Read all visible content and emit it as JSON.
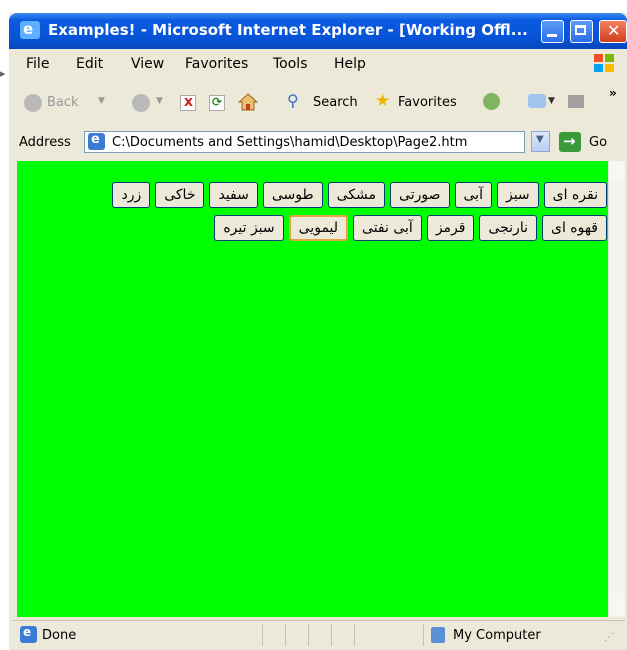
{
  "window": {
    "title": "Examples! - Microsoft Internet Explorer - [Working Offl...",
    "close_glyph": "✕"
  },
  "menu": {
    "items": [
      "File",
      "Edit",
      "View",
      "Favorites",
      "Tools",
      "Help"
    ]
  },
  "toolbar": {
    "back_label": "Back",
    "search_label": "Search",
    "favorites_label": "Favorites",
    "overflow": "»",
    "icons": [
      "back-icon",
      "forward-icon",
      "stop-icon",
      "refresh-icon",
      "home-icon",
      "search-icon",
      "favorites-icon",
      "history-icon",
      "mail-icon",
      "print-icon"
    ]
  },
  "address": {
    "label": "Address",
    "url": "C:\\Documents and Settings\\hamid\\Desktop\\Page2.htm",
    "go_label": "Go"
  },
  "content": {
    "background_color": "#00ff00",
    "button_rows": [
      [
        "نقره ای",
        "سبز",
        "آبی",
        "صورتی",
        "مشکی",
        "طوسی",
        "سفید",
        "خاکی",
        "زرد"
      ],
      [
        "قهوه ای",
        "نارنجی",
        "قرمز",
        "آبی نفتی",
        "لیمویی",
        "سبز تیره"
      ]
    ],
    "focused_button": "لیمویی"
  },
  "status": {
    "text": "Done",
    "zone": "My Computer"
  }
}
